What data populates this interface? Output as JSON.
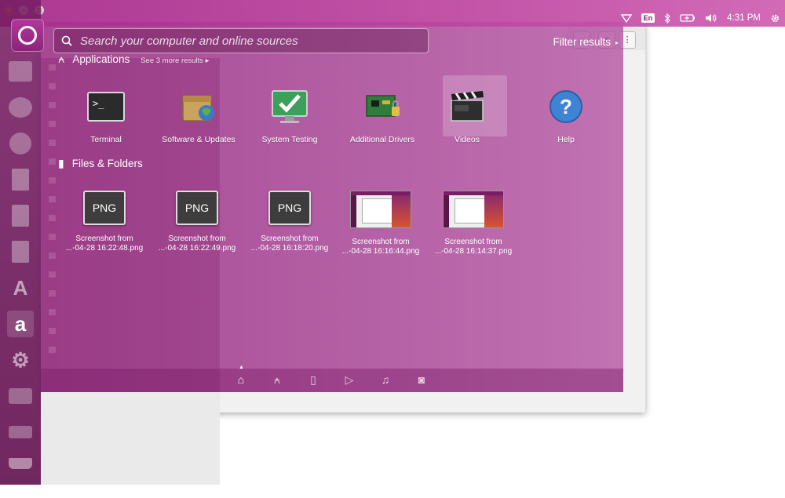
{
  "panel": {
    "window_controls": [
      "×",
      "−",
      "□"
    ],
    "keyboard_layout": "En",
    "time": "4:31 PM"
  },
  "search": {
    "placeholder": "Search your computer and online sources",
    "value": ""
  },
  "filter": {
    "label": "Filter results",
    "arrow": "▸"
  },
  "applications": {
    "title": "Applications",
    "more": "See 3 more results",
    "more_arrow": "▸",
    "items": [
      {
        "label": "Terminal",
        "icon": "terminal-icon"
      },
      {
        "label": "Software & Updates",
        "icon": "software-updates-icon"
      },
      {
        "label": "System Testing",
        "icon": "system-testing-icon"
      },
      {
        "label": "Additional Drivers",
        "icon": "additional-drivers-icon"
      },
      {
        "label": "Videos",
        "icon": "videos-icon"
      },
      {
        "label": "Help",
        "icon": "help-icon"
      }
    ]
  },
  "files": {
    "title": "Files & Folders",
    "items": [
      {
        "line1": "Screenshot from",
        "line2": "...-04-28 16:22:48.png",
        "thumb": "PNG"
      },
      {
        "line1": "Screenshot from",
        "line2": "...-04-28 16:22:49.png",
        "thumb": "PNG"
      },
      {
        "line1": "Screenshot from",
        "line2": "...-04-28 16:18:20.png",
        "thumb": "PNG"
      },
      {
        "line1": "Screenshot from",
        "line2": "...-04-28 16:16:44.png",
        "thumb": ""
      },
      {
        "line1": "Screenshot from",
        "line2": "...-04-28 16:14:37.png",
        "thumb": ""
      }
    ]
  },
  "lenses": [
    "home-lens-icon",
    "applications-lens-icon",
    "files-lens-icon",
    "video-lens-icon",
    "music-lens-icon",
    "photo-lens-icon"
  ],
  "colors": {
    "accent": "#e95420",
    "dash_tint": "#962381",
    "launcher": "#6e1a5a"
  }
}
